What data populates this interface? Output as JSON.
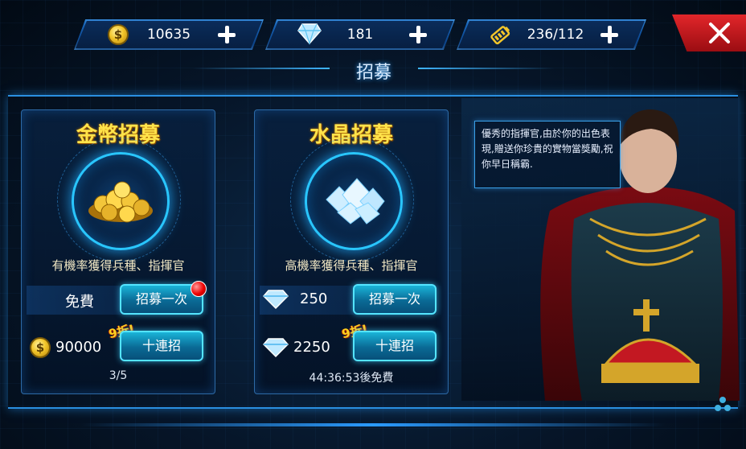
{
  "resources": {
    "gold": "10635",
    "crystal": "181",
    "energy": "236/112"
  },
  "title": "招募",
  "gold_recruit": {
    "title": "金幣招募",
    "desc": "有機率獲得兵種、指揮官",
    "free_label": "免費",
    "single_button": "招募一次",
    "ten_price": "90000",
    "discount": "9折!",
    "ten_button": "十連招",
    "count": "3/5"
  },
  "crystal_recruit": {
    "title": "水晶招募",
    "desc": "高機率獲得兵種、指揮官",
    "single_price": "250",
    "single_button": "招募一次",
    "ten_price": "2250",
    "discount": "9折!",
    "ten_button": "十連招",
    "timer": "44:36:53後免費"
  },
  "speech": "優秀的指揮官,由於你的出色表現,贈送你珍貴的實物當獎勵,祝你早日稱霸.",
  "colors": {
    "accent": "#29c6ff",
    "gold_title": "#ffe34a",
    "close": "#e2262a"
  },
  "icons": [
    "gold-coin-icon",
    "diamond-icon",
    "energy-battery-icon",
    "plus-icon",
    "close-icon",
    "menu-dots-icon"
  ]
}
